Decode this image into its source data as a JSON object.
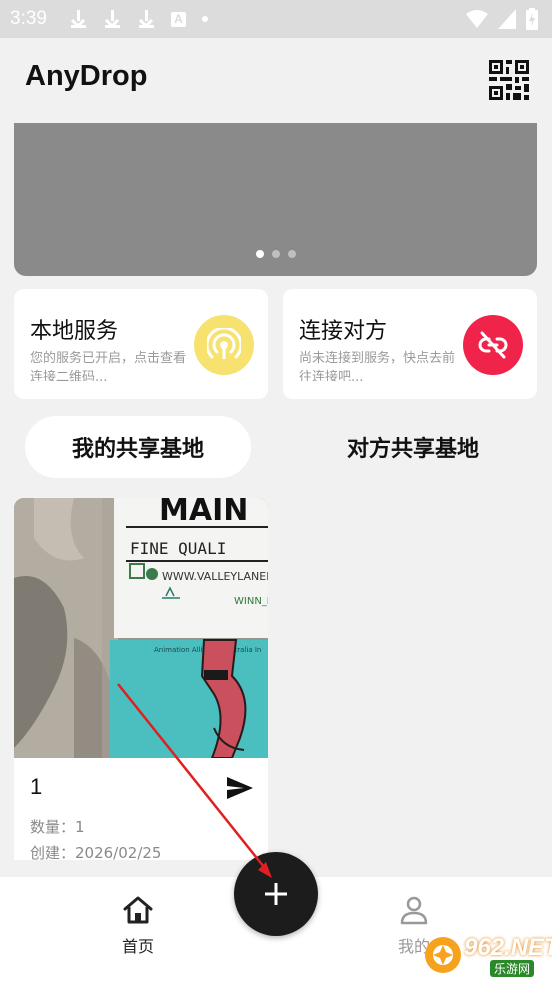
{
  "status_bar": {
    "time": "3:39"
  },
  "app_bar": {
    "title": "AnyDrop"
  },
  "banner": {
    "page_count": 3,
    "active_index": 0
  },
  "cards": {
    "local": {
      "title": "本地服务",
      "desc": "您的服务已开启，点击查看连接二维码...",
      "color": "#f7e16f"
    },
    "connect": {
      "title": "连接对方",
      "desc": "尚未连接到服务，快点去前往连接吧...",
      "color": "#f0244a"
    }
  },
  "tabs": {
    "mine": "我的共享基地",
    "other": "对方共享基地"
  },
  "share_item": {
    "name": "1",
    "quantity": "数量：1",
    "created": "创建：2026/02/25",
    "photo_text": {
      "sign_top": "MAIN",
      "sign_sub": "FINE QUALI",
      "sign_url": "WWW.VALLEYLANEM",
      "sign_small": "WINN_L",
      "poster_text": "Animation Alliance Australia In"
    }
  },
  "bottom_nav": {
    "home": "首页",
    "mine": "我的"
  },
  "watermark": {
    "brand": "962.NET",
    "sub": "乐游网"
  }
}
